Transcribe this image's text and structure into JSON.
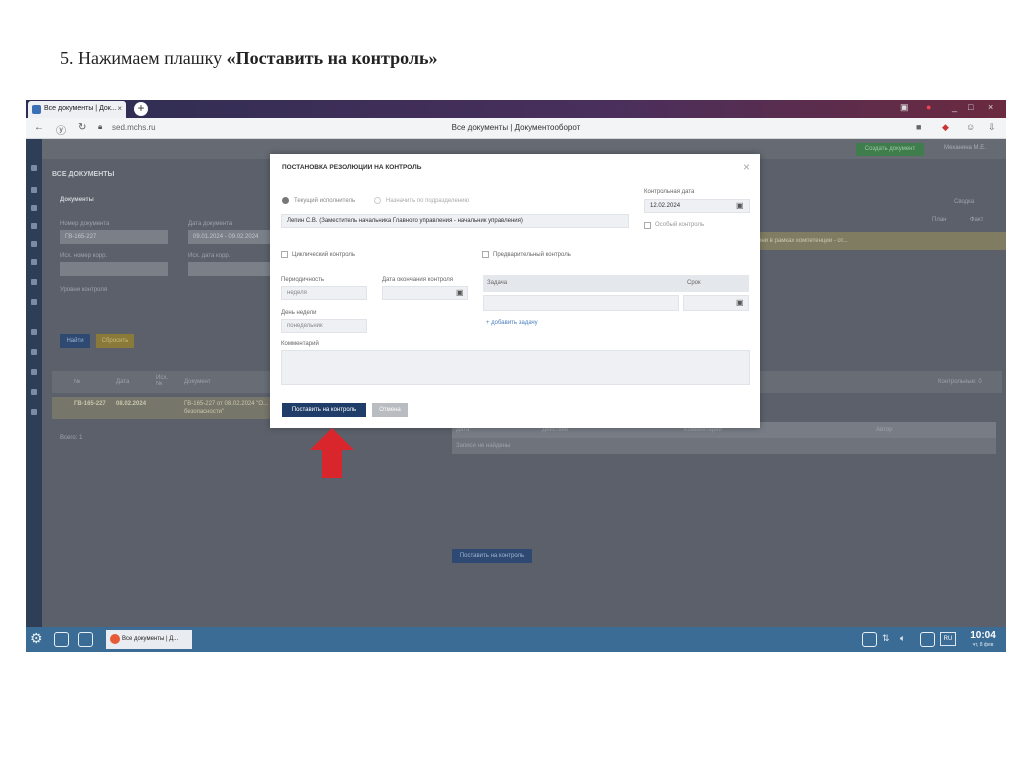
{
  "slide": {
    "step": "5. Нажимаем плашку ",
    "step_bold": "«Поставить на контроль»"
  },
  "browser": {
    "tab_title": "Все документы | Док...",
    "url": "sed.mchs.ru",
    "page_title": "Все документы | Документооборот"
  },
  "app": {
    "create_doc": "Создать документ",
    "user": "Механина М.Е.",
    "section": "ВСЕ ДОКУМЕНТЫ",
    "documents": "Документы",
    "filters": {
      "doc_number_label": "Номер документа",
      "doc_number": "ГВ-165-227",
      "doc_date_label": "Дата документа",
      "doc_date": "09.01.2024 - 09.02.2024",
      "out_number_label": "Исх. номер корр.",
      "out_date_label": "Исх. дата корр.",
      "control_check": "Уровни контроля",
      "find": "Найти",
      "reset": "Сбросить"
    },
    "table": {
      "col_num": "№",
      "col_date": "Дата",
      "col_out": "Исх. №",
      "col_doc": "Документ",
      "row_num": "ГВ-165-227",
      "row_date": "08.02.2024",
      "row_doc": "ГВ-165-227 от 08.02.2024 \"О...",
      "row_doc2": "безопасности\"",
      "total": "Всего: 1",
      "plan": "План",
      "fact": "Факт",
      "summary": "Сводка",
      "yellow_text": "ени в рамках компетенции - от...",
      "control_count": "Контрольные: 0"
    },
    "history": {
      "col_date": "Дата",
      "col_action": "Действие",
      "col_comment": "Комментарий",
      "col_author": "Автор",
      "empty": "Записи не найдены"
    },
    "put_on_control_bottom": "Поставить на контроль"
  },
  "modal": {
    "title": "ПОСТАНОВКА РЕЗОЛЮЦИИ НА КОНТРОЛЬ",
    "radio_current": "Текущий исполнитель",
    "radio_dept": "Назначить по подразделению",
    "executor": "Лепин С.В. (Заместитель начальника Главного управления - начальник управления)",
    "control_date_label": "Контрольная дата",
    "control_date": "12.02.2024",
    "special_control": "Особый контроль",
    "cyclic_control": "Циклический контроль",
    "preliminary_control": "Предварительный контроль",
    "periodicity_label": "Периодичность",
    "periodicity": "неделя",
    "end_date_label": "Дата окончания контроля",
    "weekday_label": "День недели",
    "weekday": "понедельник",
    "task_col": "Задача",
    "term_col": "Срок",
    "add_task": "+ добавить задачу",
    "comment_label": "Комментарий",
    "submit": "Поставить на контроль",
    "cancel": "Отмена"
  },
  "taskbar": {
    "task": "Все документы | Д...",
    "lang": "RU",
    "time": "10:04",
    "day": "чт, 8 фев"
  },
  "colors": {
    "accent": "#1f3d68",
    "arrow": "#d8262c",
    "taskbar": "#3b6c95"
  }
}
